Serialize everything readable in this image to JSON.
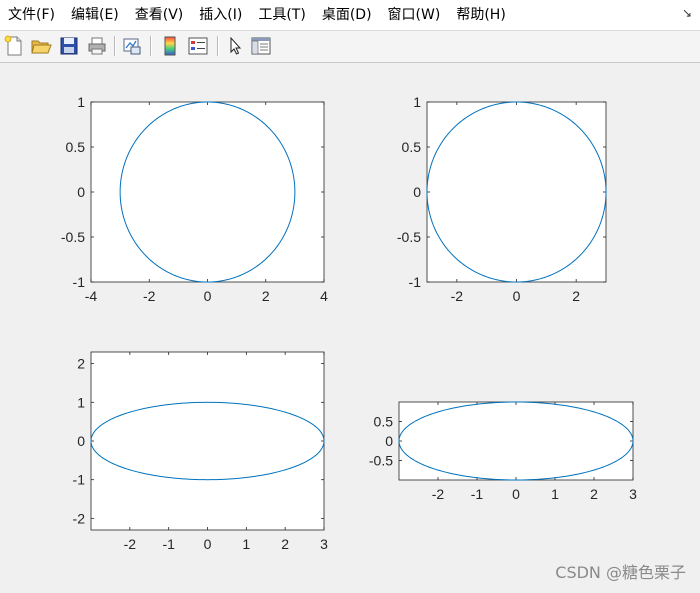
{
  "menubar": {
    "items": [
      {
        "label": "文件(F)"
      },
      {
        "label": "编辑(E)"
      },
      {
        "label": "查看(V)"
      },
      {
        "label": "插入(I)"
      },
      {
        "label": "工具(T)"
      },
      {
        "label": "桌面(D)"
      },
      {
        "label": "窗口(W)"
      },
      {
        "label": "帮助(H)"
      }
    ],
    "dock_icon": "undock-arrow-icon"
  },
  "toolbar": {
    "icons": [
      "new-figure-icon",
      "open-file-icon",
      "save-icon",
      "print-icon",
      "link-plot-icon",
      "insert-colorbar-icon",
      "insert-legend-icon",
      "edit-plot-pointer-icon",
      "property-inspector-icon"
    ]
  },
  "colors": {
    "line": "#0072bd",
    "axes_bg": "#ffffff",
    "figure_bg": "#f0f0f0",
    "toolbar_bg": "#f4f4f4"
  },
  "watermark": "CSDN @糖色栗子",
  "chart_data": [
    {
      "type": "line",
      "title": "",
      "xlabel": "",
      "ylabel": "",
      "xlim": [
        -4,
        4
      ],
      "ylim": [
        -1,
        1
      ],
      "xticks": [
        "-4",
        "-2",
        "0",
        "2",
        "4"
      ],
      "yticks": [
        "1",
        "0.5",
        "0",
        "-0.5",
        "-1"
      ],
      "series": [
        {
          "shape": "ellipse",
          "a": 3,
          "b": 1
        }
      ]
    },
    {
      "type": "line",
      "title": "",
      "xlabel": "",
      "ylabel": "",
      "xlim": [
        -3,
        3
      ],
      "ylim": [
        -1,
        1
      ],
      "xticks": [
        "-2",
        "0",
        "2"
      ],
      "yticks": [
        "1",
        "0.5",
        "0",
        "-0.5",
        "-1"
      ],
      "series": [
        {
          "shape": "ellipse",
          "a": 3,
          "b": 1
        }
      ]
    },
    {
      "type": "line",
      "title": "",
      "xlabel": "",
      "ylabel": "",
      "xlim": [
        -3,
        3
      ],
      "ylim": [
        -2.3,
        2.3
      ],
      "xticks": [
        "-2",
        "-1",
        "0",
        "1",
        "2",
        "3"
      ],
      "yticks": [
        "2",
        "1",
        "0",
        "-1",
        "-2"
      ],
      "series": [
        {
          "shape": "ellipse",
          "a": 3,
          "b": 1
        }
      ]
    },
    {
      "type": "line",
      "title": "",
      "xlabel": "",
      "ylabel": "",
      "xlim": [
        -3,
        3
      ],
      "ylim": [
        -1,
        1
      ],
      "xticks": [
        "-2",
        "-1",
        "0",
        "1",
        "2",
        "3"
      ],
      "yticks": [
        "0.5",
        "0",
        "-0.5"
      ],
      "series": [
        {
          "shape": "ellipse",
          "a": 3,
          "b": 1
        }
      ]
    }
  ]
}
